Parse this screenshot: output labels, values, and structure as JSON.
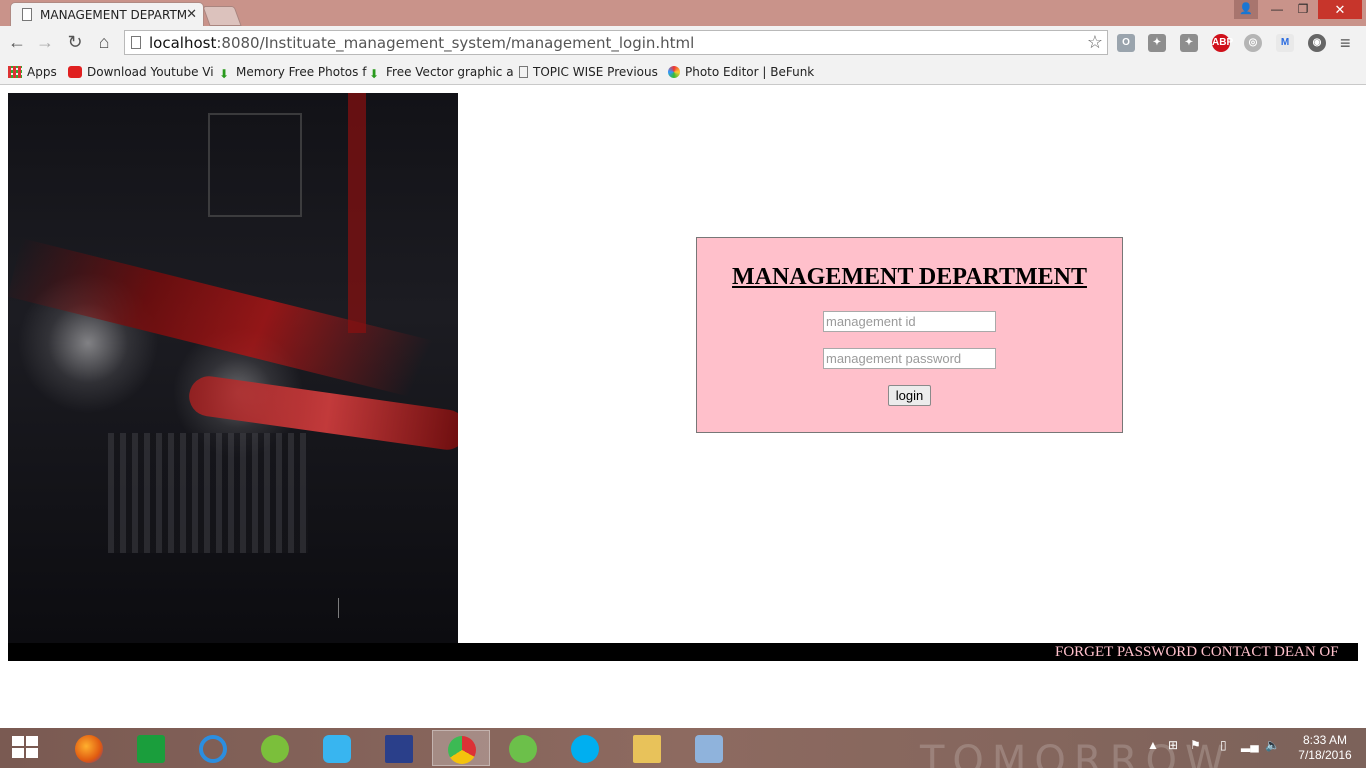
{
  "browser": {
    "tab_title": "MANAGEMENT DEPARTMENT",
    "url_host": "localhost",
    "url_rest": ":8080/Instituate_management_system/management_login.html",
    "bookmarks": [
      {
        "label": "Apps",
        "icon": "apps-grid-icon"
      },
      {
        "label": "Download Youtube Vi",
        "icon": "youtube-icon"
      },
      {
        "label": "Memory Free Photos f",
        "icon": "download-arrow-icon"
      },
      {
        "label": "Free Vector graphic a",
        "icon": "download-arrow-icon"
      },
      {
        "label": "TOPIC WISE Previous",
        "icon": "page-icon"
      },
      {
        "label": "Photo Editor | BeFunk",
        "icon": "befunky-icon"
      }
    ]
  },
  "login": {
    "heading": "MANAGEMENT DEPARTMENT",
    "id_placeholder": "management id",
    "password_placeholder": "management password",
    "button_label": "login"
  },
  "footer": {
    "marquee_text": "FORGET PASSWORD CONTACT DEAN OF"
  },
  "taskbar": {
    "time": "8:33 AM",
    "date": "7/18/2016",
    "wallpaper_text": "TOMORROW"
  },
  "colors": {
    "login_background": "#ffc0cb",
    "marquee_text": "#ffc0cb",
    "titlebar": "#c9938a"
  }
}
